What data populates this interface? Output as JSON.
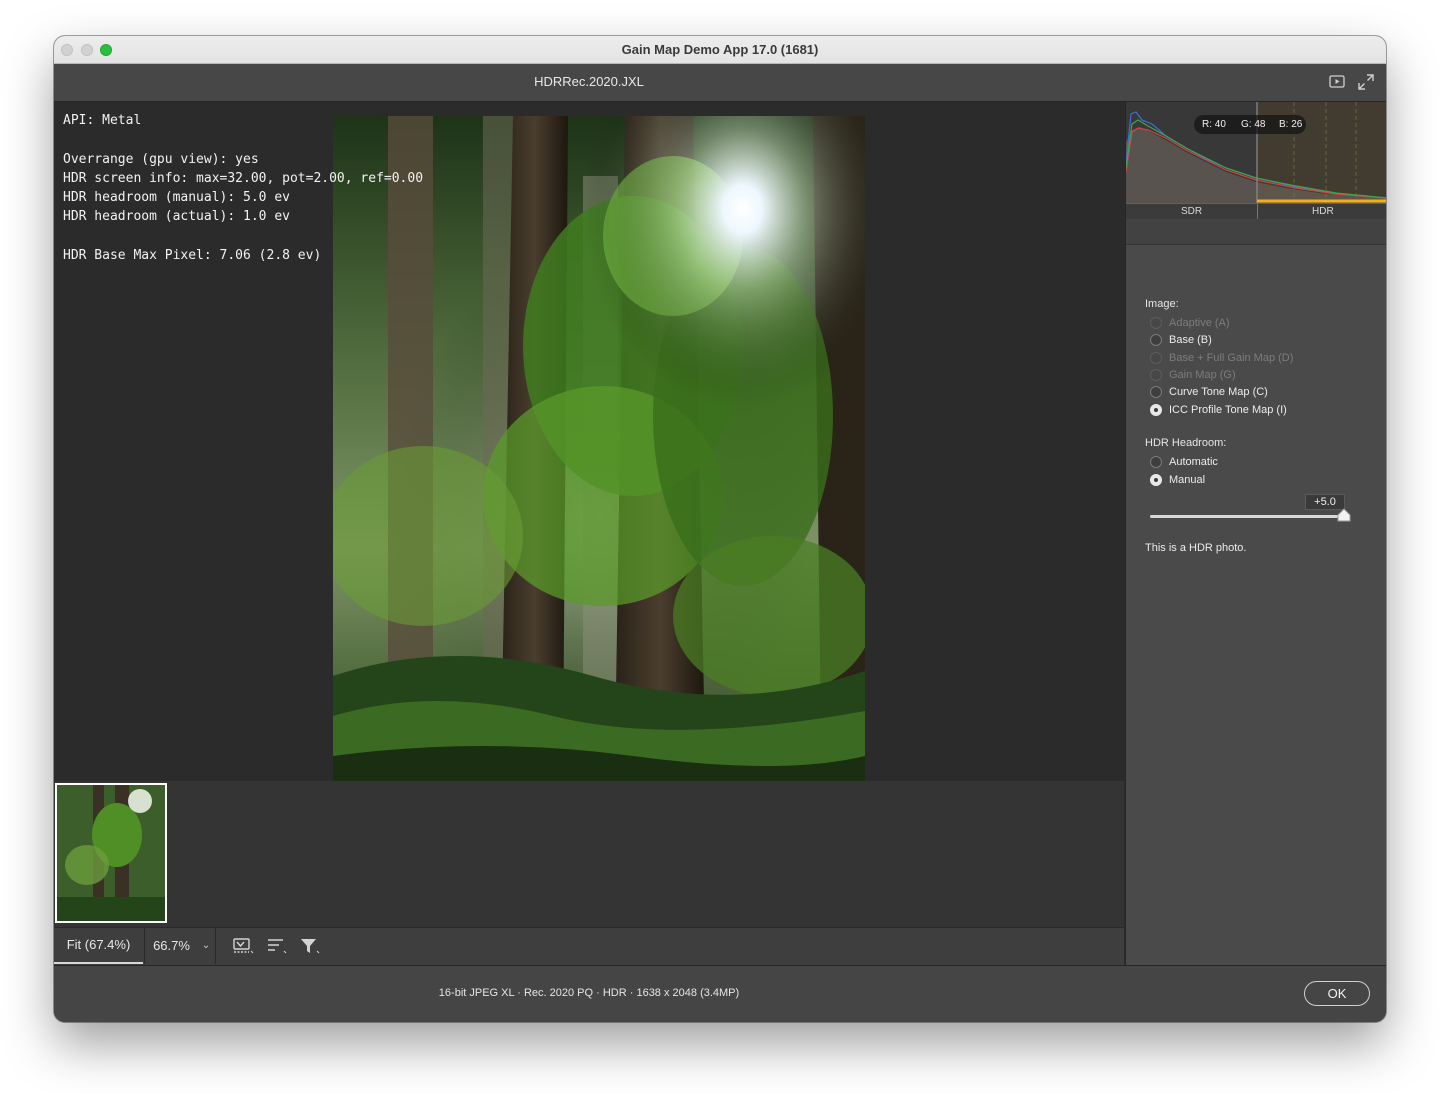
{
  "window": {
    "title": "Gain Map Demo App 17.0 (1681)"
  },
  "header": {
    "filename": "HDRRec.2020.JXL",
    "icons": [
      "play-slideshow-icon",
      "fullscreen-icon"
    ]
  },
  "overlay": {
    "lines": "API: Metal\n\nOverrange (gpu view): yes\nHDR screen info: max=32.00, pot=2.00, ref=0.00\nHDR headroom (manual): 5.0 ev\nHDR headroom (actual): 1.0 ev\n\nHDR Base Max Pixel: 7.06 (2.8 ev)"
  },
  "zoombar": {
    "fit_label": "Fit (67.4%)",
    "zoom_value": "66.7%",
    "chevron": "⌄",
    "icons": [
      "gain-map-view-icon",
      "sort-icon",
      "filter-icon"
    ]
  },
  "histogram": {
    "readout": {
      "r": "R: 40",
      "g": "G: 48",
      "b": "B: 26"
    },
    "sdr_label": "SDR",
    "hdr_label": "HDR",
    "colors": {
      "red": "#d94141",
      "green": "#3ea64a",
      "blue": "#3f6fd6",
      "hdr_zone": "#f2b01e"
    }
  },
  "panel": {
    "image_label": "Image:",
    "image_options": [
      {
        "label": "Adaptive (A)",
        "enabled": false,
        "selected": false
      },
      {
        "label": "Base (B)",
        "enabled": true,
        "selected": false
      },
      {
        "label": "Base + Full Gain Map (D)",
        "enabled": false,
        "selected": false
      },
      {
        "label": "Gain Map (G)",
        "enabled": false,
        "selected": false
      },
      {
        "label": "Curve Tone Map (C)",
        "enabled": true,
        "selected": false
      },
      {
        "label": "ICC Profile Tone Map (I)",
        "enabled": true,
        "selected": true
      }
    ],
    "headroom_label": "HDR Headroom:",
    "headroom_options": [
      {
        "label": "Automatic",
        "enabled": true,
        "selected": false
      },
      {
        "label": "Manual",
        "enabled": true,
        "selected": true
      }
    ],
    "slider_value": "+5.0",
    "slider_fraction": 1.0,
    "note": "This is a HDR photo."
  },
  "footer": {
    "info": "16-bit JPEG XL  ·  Rec. 2020 PQ  ·  HDR  ·  1638 x 2048 (3.4MP)",
    "ok_label": "OK"
  }
}
